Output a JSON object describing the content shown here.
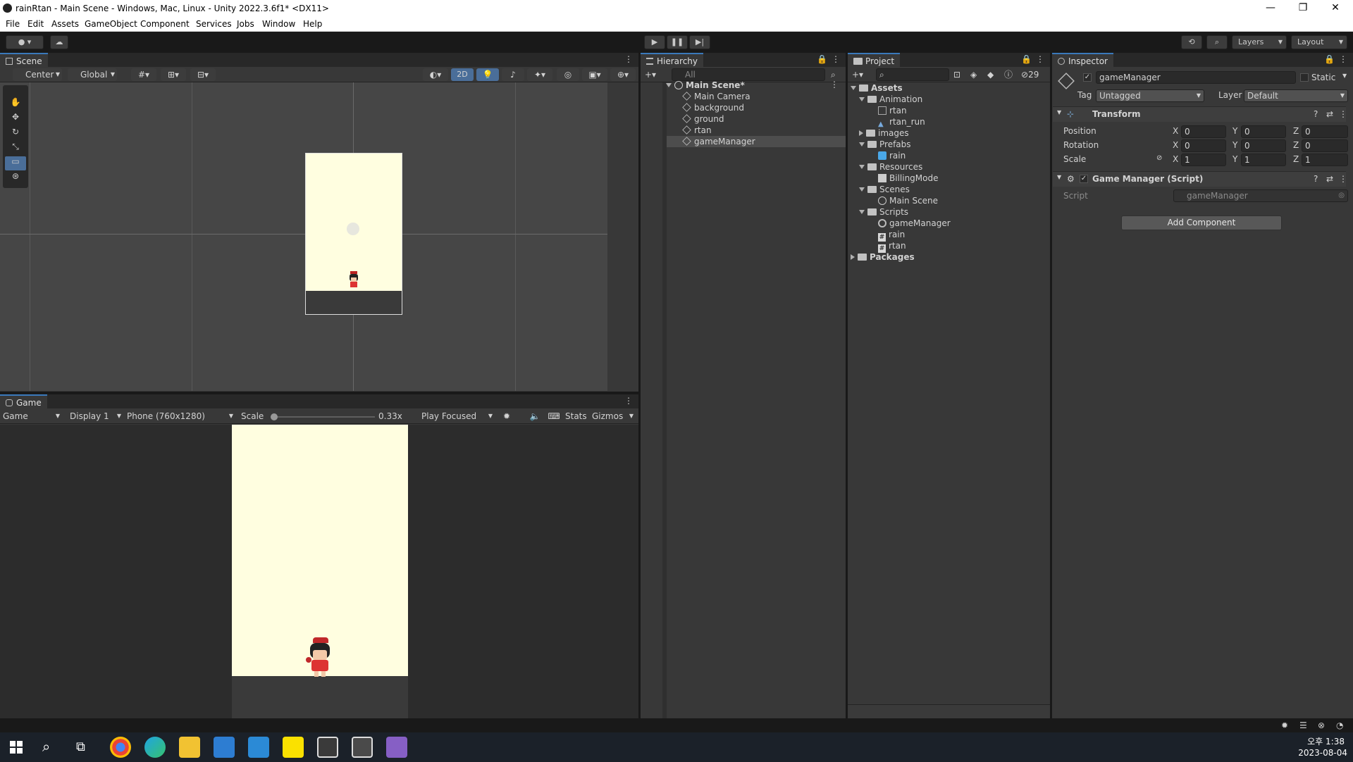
{
  "window": {
    "title": "rainRtan - Main Scene - Windows, Mac, Linux - Unity 2022.3.6f1* <DX11>",
    "minimize": "—",
    "maximize": "❐",
    "close": "✕"
  },
  "menu": [
    "File",
    "Edit",
    "Assets",
    "GameObject",
    "Component",
    "Services",
    "Jobs",
    "Window",
    "Help"
  ],
  "toolbar": {
    "layers_label": "Layers",
    "layout_label": "Layout",
    "play": "▶",
    "pause": "❚❚",
    "step": "▶|"
  },
  "scene": {
    "tab": "Scene",
    "pivot": "Center",
    "space": "Global",
    "mode_2d": "2D"
  },
  "game": {
    "tab": "Game",
    "view": "Game",
    "display": "Display 1",
    "resolution": "Phone (760x1280)",
    "scale_label": "Scale",
    "scale_value": "0.33x",
    "play_mode": "Play Focused",
    "stats": "Stats",
    "gizmos": "Gizmos"
  },
  "hierarchy": {
    "tab": "Hierarchy",
    "search_placeholder": "All",
    "scene_name": "Main Scene*",
    "items": [
      "Main Camera",
      "background",
      "ground",
      "rtan",
      "gameManager"
    ]
  },
  "project": {
    "tab": "Project",
    "hidden_count": "29",
    "tree": {
      "assets": "Assets",
      "animation": "Animation",
      "anim_rtan": "rtan",
      "anim_rtan_run": "rtan_run",
      "images": "images",
      "prefabs": "Prefabs",
      "prefab_rain": "rain",
      "resources": "Resources",
      "billing": "BillingMode",
      "scenes": "Scenes",
      "main_scene": "Main Scene",
      "scripts": "Scripts",
      "script_gm": "gameManager",
      "script_rain": "rain",
      "script_rtan": "rtan",
      "packages": "Packages"
    }
  },
  "inspector": {
    "tab": "Inspector",
    "object_name": "gameManager",
    "static_label": "Static",
    "tag_label": "Tag",
    "tag_value": "Untagged",
    "layer_label": "Layer",
    "layer_value": "Default",
    "transform": {
      "title": "Transform",
      "position_label": "Position",
      "rotation_label": "Rotation",
      "scale_label": "Scale",
      "x": "X",
      "y": "Y",
      "z": "Z",
      "position": [
        "0",
        "0",
        "0"
      ],
      "rotation": [
        "0",
        "0",
        "0"
      ],
      "scale": [
        "1",
        "1",
        "1"
      ]
    },
    "script_component": {
      "title": "Game Manager (Script)",
      "script_label": "Script",
      "script_value": "gameManager"
    },
    "add_component": "Add Component"
  },
  "taskbar": {
    "time": "오후 1:38",
    "date": "2023-08-04"
  },
  "colors": {
    "accent": "#3a79bb",
    "panel": "#383838",
    "scene_bg": "#464646",
    "game_canvas": "#fffee0",
    "ground": "#3a3a3a"
  }
}
